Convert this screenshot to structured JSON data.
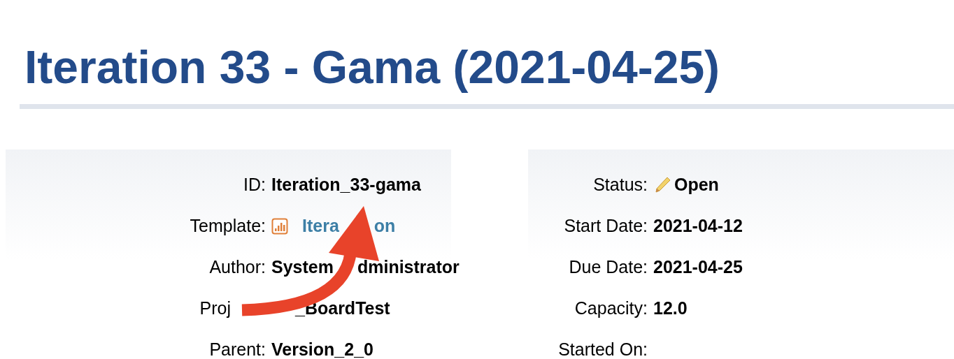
{
  "title": "Iteration 33 - Gama (2021-04-25)",
  "columns": [
    {
      "fields": [
        {
          "kind": "text",
          "label": [
            {
              "kind": "text",
              "text": "ID:"
            }
          ],
          "value": [
            {
              "kind": "text",
              "text": "Iteration_33-gama"
            }
          ]
        },
        {
          "kind": "link",
          "label": [
            {
              "kind": "text",
              "text": "Template:"
            }
          ],
          "value": [
            {
              "kind": "text",
              "text": "Itera"
            },
            {
              "kind": "wide_gap"
            },
            {
              "kind": "text",
              "text": "on"
            }
          ]
        },
        {
          "kind": "text",
          "label": [
            {
              "kind": "text",
              "text": "Author:"
            }
          ],
          "value": [
            {
              "kind": "text",
              "text": "System"
            },
            {
              "kind": "gap"
            },
            {
              "kind": "text",
              "text": "dministrator"
            }
          ]
        },
        {
          "kind": "text",
          "label": [
            {
              "kind": "text",
              "text": "Proj"
            },
            {
              "kind": "wide_gap"
            }
          ],
          "value": [
            {
              "kind": "gap"
            },
            {
              "kind": "text",
              "text": "_BoardTest"
            }
          ]
        },
        {
          "kind": "text",
          "label": [
            {
              "kind": "text",
              "text": "Parent:"
            }
          ],
          "value": [
            {
              "kind": "text",
              "text": "Version_2_0"
            }
          ]
        }
      ]
    },
    {
      "fields": [
        {
          "kind": "status",
          "label": [
            {
              "kind": "text",
              "text": "Status:"
            }
          ],
          "value": [
            {
              "kind": "text",
              "text": "Open"
            }
          ]
        },
        {
          "kind": "text",
          "label": [
            {
              "kind": "text",
              "text": "Start Date:"
            }
          ],
          "value": [
            {
              "kind": "text",
              "text": "2021-04-12"
            }
          ]
        },
        {
          "kind": "text",
          "label": [
            {
              "kind": "text",
              "text": "Due Date:"
            }
          ],
          "value": [
            {
              "kind": "text",
              "text": "2021-04-25"
            }
          ]
        },
        {
          "kind": "text",
          "label": [
            {
              "kind": "text",
              "text": "Capacity:"
            }
          ],
          "value": [
            {
              "kind": "text",
              "text": "12.0"
            }
          ]
        },
        {
          "kind": "text",
          "label": [
            {
              "kind": "text",
              "text": "Started On:"
            }
          ]
        }
      ]
    }
  ]
}
